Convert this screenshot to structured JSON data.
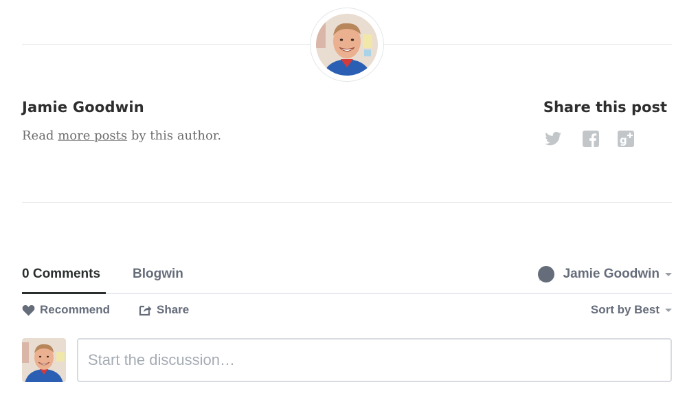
{
  "author": {
    "avatar_icon": "author-photo",
    "name": "Jamie Goodwin",
    "bio_prefix": "Read ",
    "bio_link": "more posts",
    "bio_suffix": " by this author."
  },
  "share": {
    "title": "Share this post",
    "icons": [
      "twitter-icon",
      "facebook-icon",
      "google-plus-icon"
    ],
    "icon_color": "#c2c6c9"
  },
  "comments": {
    "tabs": {
      "comments_label": "0 Comments",
      "forum_label": "Blogwin"
    },
    "user_menu": {
      "username": "Jamie Goodwin"
    },
    "actions": {
      "recommend_label": "Recommend",
      "share_label": "Share",
      "sort_label": "Sort by Best"
    },
    "composer": {
      "placeholder": "Start the discussion…"
    },
    "colors": {
      "primary_text": "#2a2e2e",
      "secondary_text": "#656c7a",
      "border": "#d7dbdf"
    }
  }
}
